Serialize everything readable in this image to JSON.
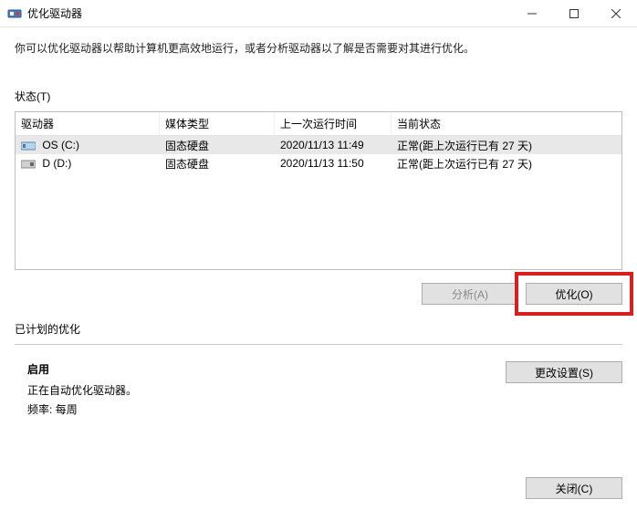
{
  "titlebar": {
    "title": "优化驱动器"
  },
  "description": "你可以优化驱动器以帮助计算机更高效地运行，或者分析驱动器以了解是否需要对其进行优化。",
  "status_label": "状态(T)",
  "table": {
    "headers": {
      "drive": "驱动器",
      "media": "媒体类型",
      "lastrun": "上一次运行时间",
      "status": "当前状态"
    },
    "rows": [
      {
        "name": "OS (C:)",
        "media": "固态硬盘",
        "lastrun": "2020/11/13 11:49",
        "status": "正常(距上次运行已有 27 天)",
        "selected": true
      },
      {
        "name": "D (D:)",
        "media": "固态硬盘",
        "lastrun": "2020/11/13 11:50",
        "status": "正常(距上次运行已有 27 天)",
        "selected": false
      }
    ]
  },
  "buttons": {
    "analyze": "分析(A)",
    "optimize": "优化(O)",
    "change_settings": "更改设置(S)",
    "close": "关闭(C)"
  },
  "schedule": {
    "header": "已计划的优化",
    "on": "启用",
    "desc": "正在自动优化驱动器。",
    "freq_label": "频率:",
    "freq_value": "每周"
  }
}
